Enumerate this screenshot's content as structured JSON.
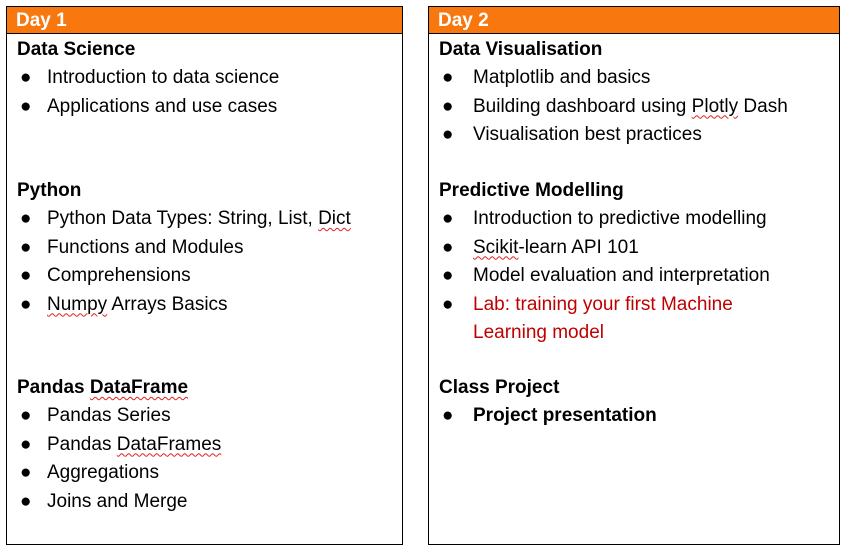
{
  "colors": {
    "header_bg": "#f8770e",
    "header_text": "#ffffff",
    "highlight_text": "#c00000",
    "border": "#000000"
  },
  "days": [
    {
      "header": "Day 1",
      "sections": [
        {
          "title": "Data Science",
          "items": [
            "Introduction to data science",
            "Applications and use cases"
          ]
        },
        {
          "title": "Python",
          "items": [
            "Python Data Types: String, List, ",
            "Functions and Modules",
            "Comprehensions",
            " Arrays Basics"
          ],
          "spell": {
            "item0_suffix": "Dict",
            "item3_prefix": "Numpy"
          }
        },
        {
          "title_prefix": "Pandas ",
          "title_spell": "DataFrame",
          "items": [
            "Pandas Series",
            "Pandas ",
            "Aggregations",
            "Joins and Merge"
          ],
          "spell": {
            "item1_suffix": "DataFrames"
          }
        }
      ]
    },
    {
      "header": "Day 2",
      "sections": [
        {
          "title": "Data Visualisation",
          "items": [
            "Matplotlib and basics",
            "Building dashboard using ",
            "Visualisation best practices"
          ],
          "spell": {
            "item1_word": "Plotly",
            "item1_rest": " Dash"
          }
        },
        {
          "title": "Predictive Modelling",
          "items": [
            "Introduction to predictive modelling",
            "-learn API 101",
            "Model evaluation and interpretation",
            "Lab: training your first Machine Learning model"
          ],
          "spell": {
            "item1_prefix": "Scikit"
          }
        },
        {
          "title": "Class Project",
          "items": [
            "Project presentation"
          ]
        }
      ]
    }
  ],
  "bullet_glyph": "●"
}
